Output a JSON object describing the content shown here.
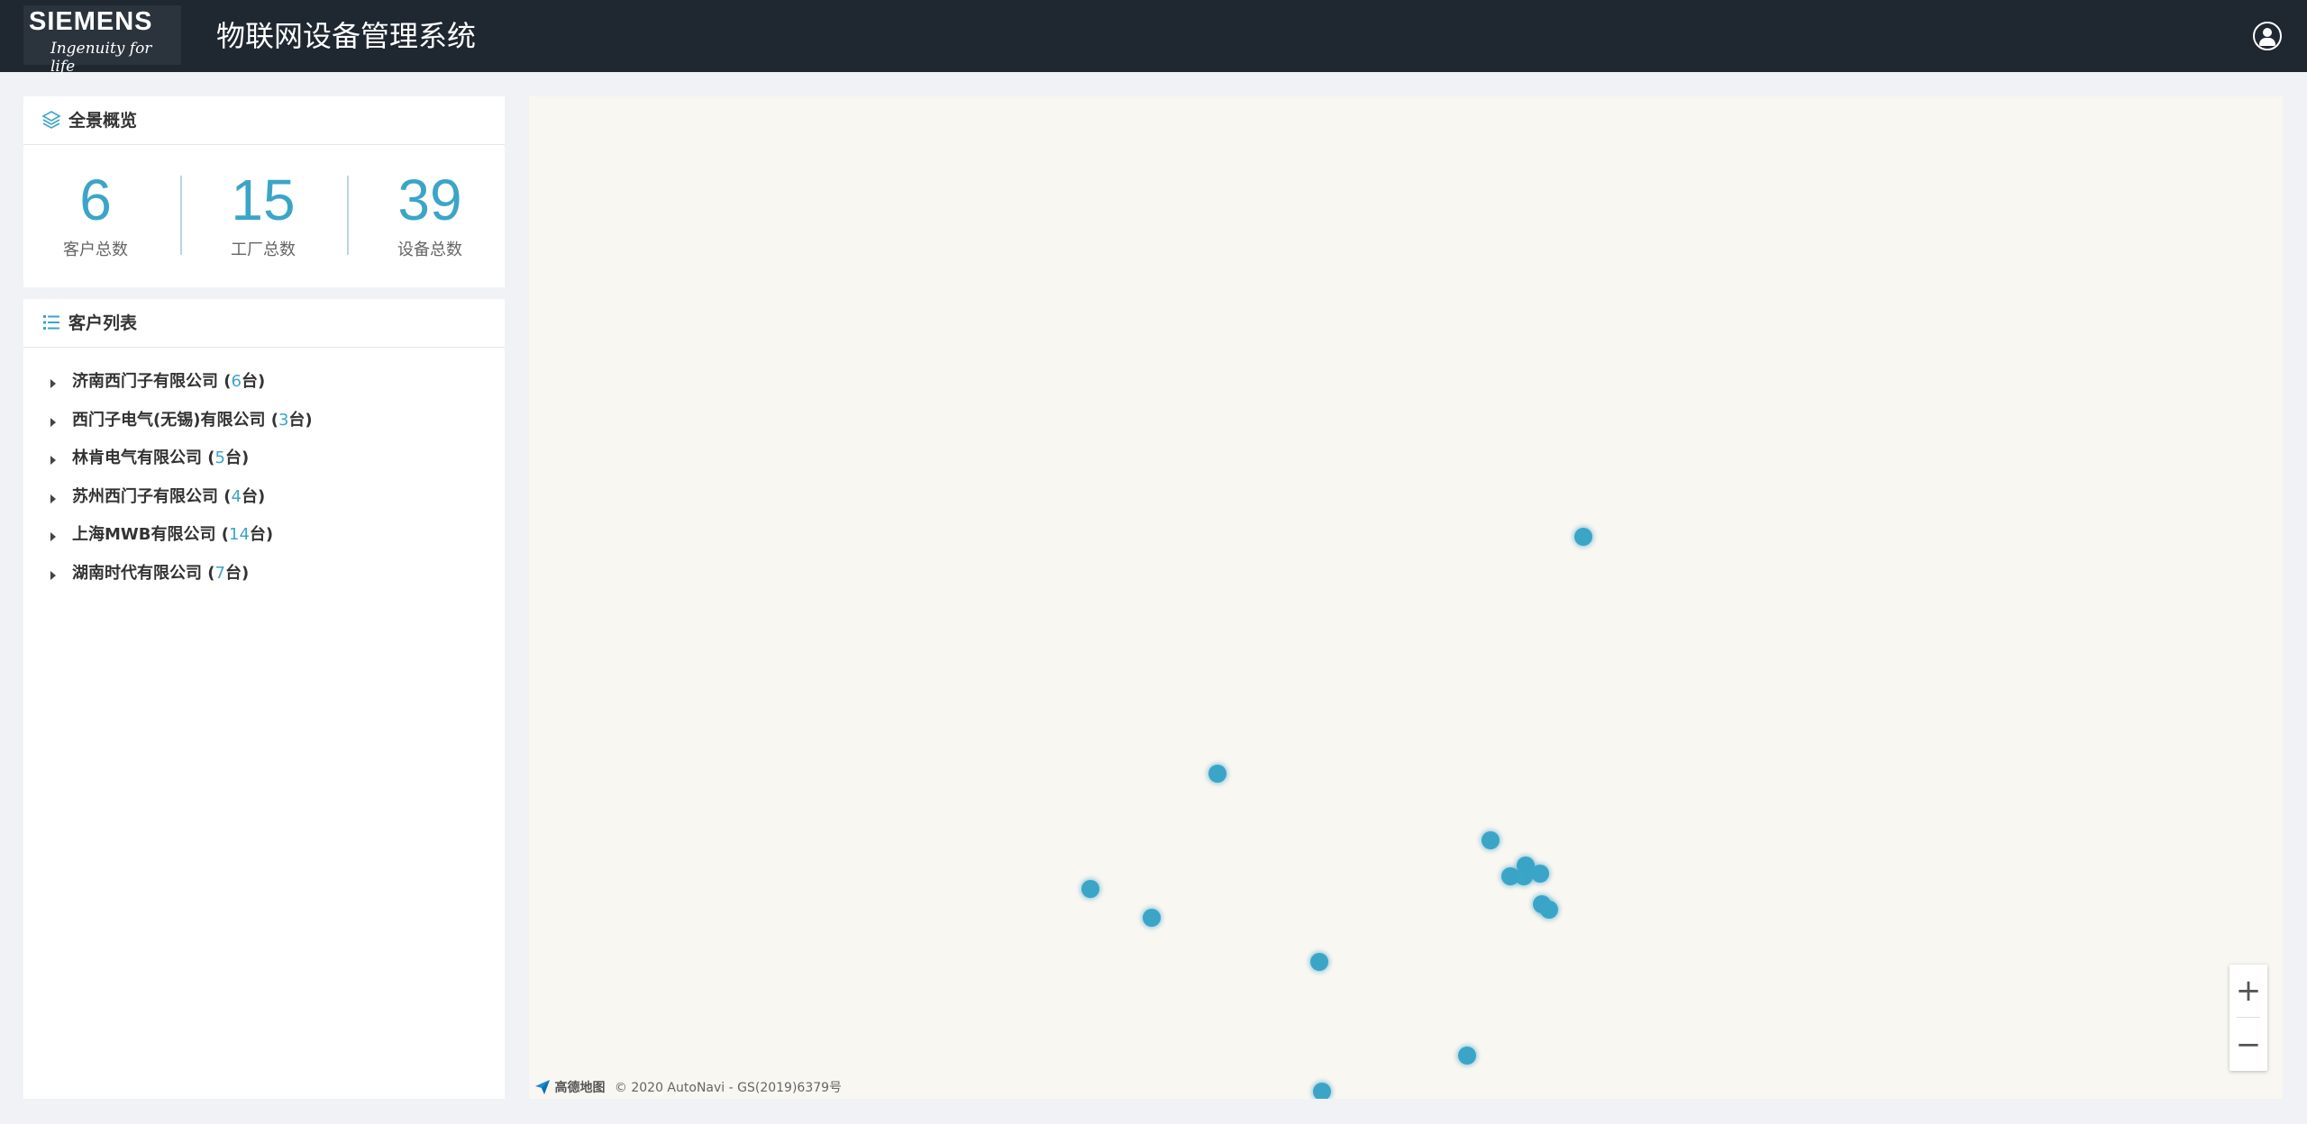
{
  "header": {
    "logo_main": "SIEMENS",
    "logo_tagline": "Ingenuity for life",
    "title": "物联网设备管理系统",
    "user_icon": "user-circle-icon"
  },
  "overview": {
    "title": "全景概览",
    "icon": "layers-icon",
    "stats": [
      {
        "value": "6",
        "label": "客户总数"
      },
      {
        "value": "15",
        "label": "工厂总数"
      },
      {
        "value": "39",
        "label": "设备总数"
      }
    ]
  },
  "customer_list": {
    "title": "客户列表",
    "icon": "list-icon",
    "items": [
      {
        "name": "济南西门子有限公司",
        "count": "6"
      },
      {
        "name": "西门子电气(无锡)有限公司",
        "count": "3"
      },
      {
        "name": "林肯电气有限公司",
        "count": "5"
      },
      {
        "name": "苏州西门子有限公司",
        "count": "4"
      },
      {
        "name": "上海MWB有限公司",
        "count": "14"
      },
      {
        "name": "湖南时代有限公司",
        "count": "7"
      }
    ],
    "count_open": " (",
    "count_suffix": "台)"
  },
  "map": {
    "zoom_in": "+",
    "zoom_out": "−",
    "provider": "高德地图",
    "copyright": "© 2020 AutoNavi - GS(2019)6379号",
    "marker_color": "#3ba5c8",
    "marker_count": 14
  },
  "colors": {
    "header_bg": "#1f2731",
    "accent": "#3ba5c8",
    "map_bg": "#f9f7f2"
  }
}
